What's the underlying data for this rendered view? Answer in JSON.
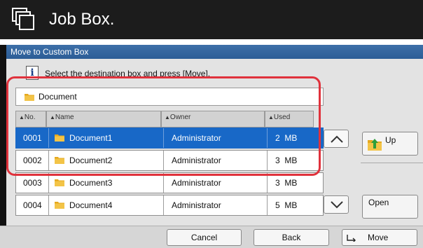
{
  "app": {
    "title": "Job Box."
  },
  "dialog": {
    "title": "Move to Custom Box",
    "instruction": "Select the destination box and press [Move].",
    "current_path": "Document"
  },
  "columns": [
    {
      "label": "No."
    },
    {
      "label": "Name"
    },
    {
      "label": "Owner"
    },
    {
      "label": "Used"
    }
  ],
  "rows": [
    {
      "no": "0001",
      "name": "Document1",
      "owner": "Administrator",
      "used": "2  MB",
      "selected": true
    },
    {
      "no": "0002",
      "name": "Document2",
      "owner": "Administrator",
      "used": "3  MB",
      "selected": false
    },
    {
      "no": "0003",
      "name": "Document3",
      "owner": "Administrator",
      "used": "3  MB",
      "selected": false
    },
    {
      "no": "0004",
      "name": "Document4",
      "owner": "Administrator",
      "used": "5  MB",
      "selected": false
    }
  ],
  "side": {
    "up_label": "Up",
    "open_label": "Open"
  },
  "footer": {
    "cancel": "Cancel",
    "back": "Back",
    "move": "Move"
  },
  "icons": {
    "app": "job-box-icon",
    "info": "info-icon",
    "folder": "folder-icon",
    "up_arrow": "chevron-up-icon",
    "down_arrow": "chevron-down-icon",
    "up_folder": "folder-up-icon",
    "enter": "enter-key-icon"
  },
  "colors": {
    "selected_row": "#1868c7",
    "highlight": "#e0323c",
    "header": "#2c5d96"
  }
}
